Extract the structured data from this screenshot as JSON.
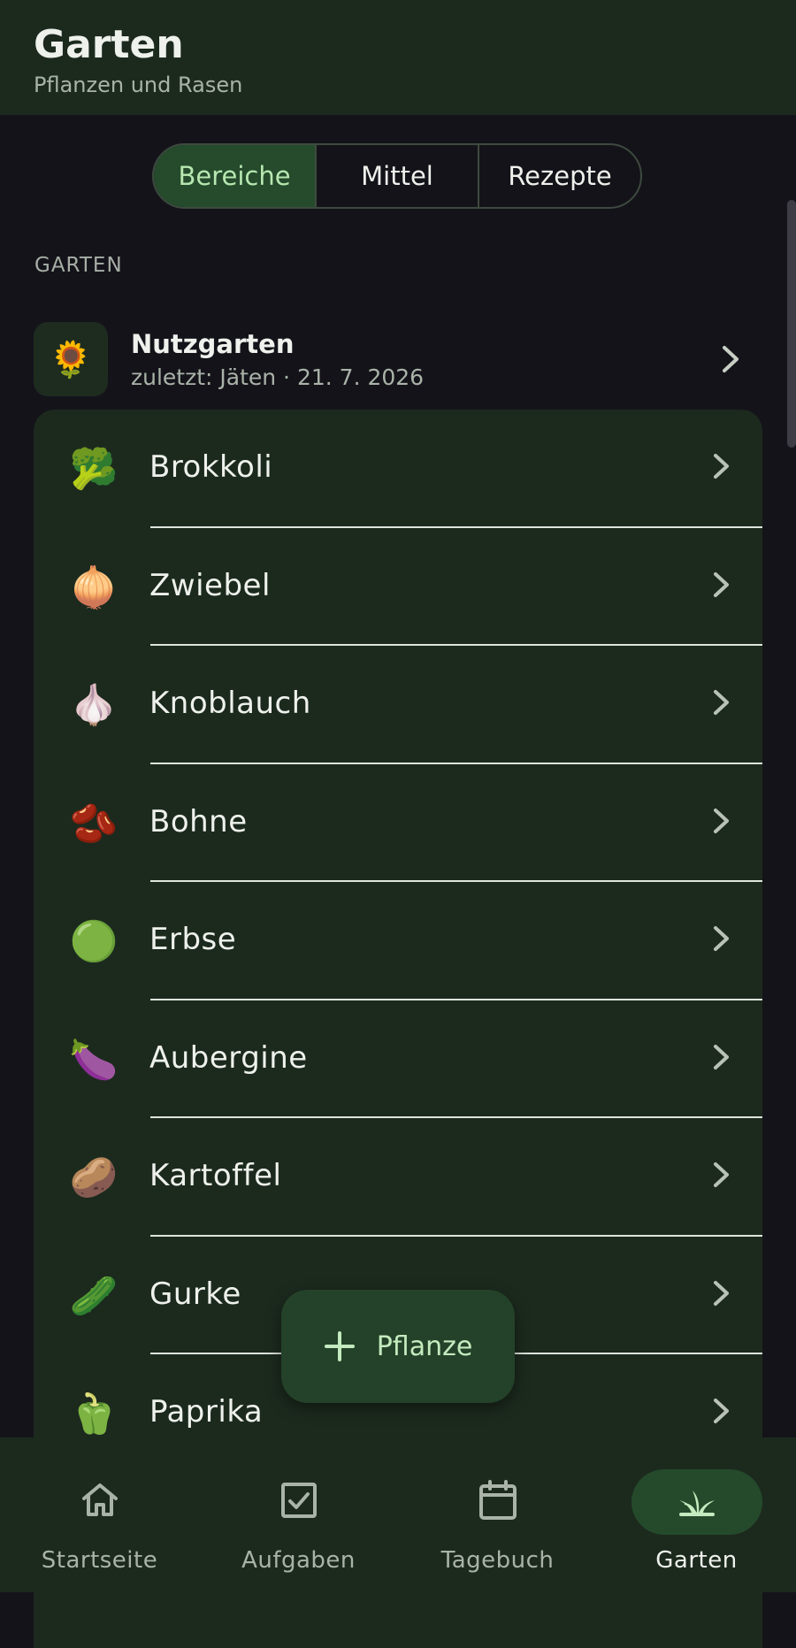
{
  "header": {
    "title": "Garten",
    "subtitle": "Pflanzen und Rasen"
  },
  "tabs": [
    {
      "label": "Bereiche",
      "active": true
    },
    {
      "label": "Mittel",
      "active": false
    },
    {
      "label": "Rezepte",
      "active": false
    }
  ],
  "section_label": "GARTEN",
  "area": {
    "icon": "🌻",
    "name": "Nutzgarten",
    "meta": "zuletzt: Jäten · 21. 7. 2026"
  },
  "plants": [
    {
      "icon": "🥦",
      "name": "Brokkoli"
    },
    {
      "icon": "🧅",
      "name": "Zwiebel"
    },
    {
      "icon": "🧄",
      "name": "Knoblauch"
    },
    {
      "icon": "🫘",
      "name": "Bohne"
    },
    {
      "icon": "🟢",
      "name": "Erbse"
    },
    {
      "icon": "🍆",
      "name": "Aubergine"
    },
    {
      "icon": "🥔",
      "name": "Kartoffel"
    },
    {
      "icon": "🥒",
      "name": "Gurke"
    },
    {
      "icon": "🫑",
      "name": "Paprika"
    }
  ],
  "fab": {
    "label": "Pflanze",
    "icon": "plus-icon"
  },
  "nav": [
    {
      "label": "Startseite",
      "icon": "home-icon",
      "active": false
    },
    {
      "label": "Aufgaben",
      "icon": "checkbox-icon",
      "active": false
    },
    {
      "label": "Tagebuch",
      "icon": "calendar-icon",
      "active": false
    },
    {
      "label": "Garten",
      "icon": "plant-icon",
      "active": true
    }
  ],
  "colors": {
    "background": "#14131a",
    "surface": "#1c2a1e",
    "accent": "#254a2c",
    "accent_text": "#b7e7b0"
  }
}
